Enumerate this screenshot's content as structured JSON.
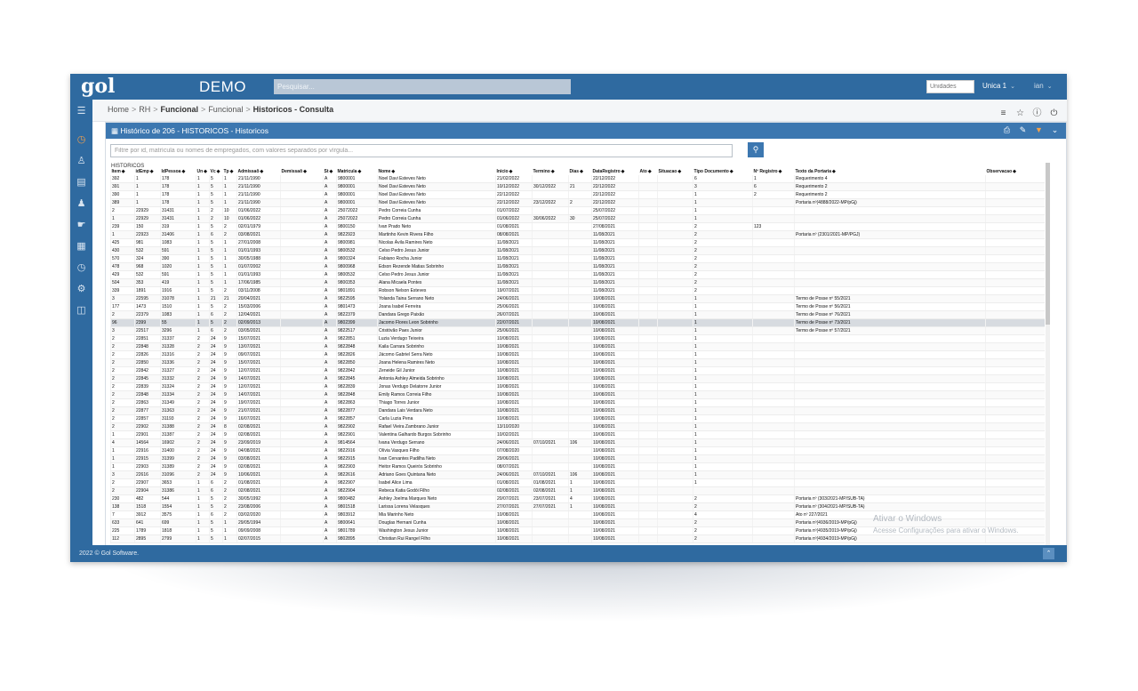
{
  "header": {
    "logo": "gol",
    "app_name": "DEMO",
    "search_placeholder": "Pesquisar...",
    "unidades_label": "Unidades",
    "unit_dropdown": "Unica 1",
    "user_dropdown": "ian"
  },
  "breadcrumb": {
    "items": [
      "Home",
      "RH",
      "Funcional",
      "Funcional",
      "Historicos - Consulta"
    ]
  },
  "panel": {
    "title": "Histórico de 206 - HISTORICOS - Historicos",
    "filter_placeholder": "Filtre por id, matrícula ou nomes de empregados, com valores separados por vírgula...",
    "caption": "HISTORICOS"
  },
  "table": {
    "columns": [
      "Item",
      "idEmp",
      "IdPessoa",
      "Un",
      "Vc",
      "Tp",
      "Admissaõ",
      "Demissaõ",
      "St",
      "Matricula",
      "Nome",
      "Inicio",
      "Termino",
      "Dias",
      "DataRegistro",
      "Ato",
      "Situacao",
      "Tipo Documento",
      "Nº Registro",
      "Texto da Portaria",
      "Observacao"
    ],
    "rows": [
      [
        "392",
        "1",
        "178",
        "1",
        "5",
        "1",
        "21/11/1990",
        "",
        "A",
        "9800001",
        "Noel Davi Esteves Neto",
        "21/02/2022",
        "",
        "",
        "22/12/2022",
        "",
        "",
        "6",
        "1",
        "Requerimento 4",
        ""
      ],
      [
        "391",
        "1",
        "178",
        "1",
        "5",
        "1",
        "21/11/1990",
        "",
        "A",
        "9800001",
        "Noel Davi Esteves Neto",
        "10/12/2022",
        "30/12/2022",
        "21",
        "22/12/2022",
        "",
        "",
        "3",
        "6",
        "Requerimento 2",
        ""
      ],
      [
        "390",
        "1",
        "178",
        "1",
        "5",
        "1",
        "21/11/1990",
        "",
        "A",
        "9800001",
        "Noel Davi Esteves Neto",
        "22/12/2022",
        "",
        "",
        "22/12/2022",
        "",
        "",
        "1",
        "2",
        "Requerimento 2",
        ""
      ],
      [
        "389",
        "1",
        "178",
        "1",
        "5",
        "1",
        "21/11/1990",
        "",
        "A",
        "9800001",
        "Noel Davi Esteves Neto",
        "22/12/2022",
        "23/12/2022",
        "2",
        "22/12/2022",
        "",
        "",
        "1",
        "",
        "Portaria nº(4888/2022-MP/pGj)",
        ""
      ],
      [
        "2",
        "22929",
        "31431",
        "1",
        "2",
        "10",
        "01/06/2022",
        "",
        "A",
        "25072022",
        "Pedro Correia Cunha",
        "01/07/2022",
        "",
        "",
        "25/07/2022",
        "",
        "",
        "1",
        "",
        "",
        ""
      ],
      [
        "1",
        "22929",
        "31431",
        "1",
        "2",
        "10",
        "01/06/2022",
        "",
        "A",
        "25072022",
        "Pedro Correia Cunha",
        "01/06/2022",
        "30/06/2022",
        "30",
        "25/07/2022",
        "",
        "",
        "1",
        "",
        "",
        ""
      ],
      [
        "239",
        "150",
        "319",
        "1",
        "5",
        "2",
        "02/01/1979",
        "",
        "A",
        "9800150",
        "Ivan Prado Neto",
        "01/08/2021",
        "",
        "",
        "27/08/2021",
        "",
        "",
        "2",
        "123",
        "",
        ""
      ],
      [
        "1",
        "22923",
        "31406",
        "1",
        "6",
        "2",
        "03/08/2021",
        "",
        "A",
        "9822923",
        "Martinho Kevin Rivera Filho",
        "08/08/2021",
        "",
        "",
        "11/08/2021",
        "",
        "",
        "2",
        "",
        "Portaria nº (2301/2021-MP/PGJ)",
        ""
      ],
      [
        "425",
        "981",
        "1083",
        "1",
        "5",
        "1",
        "27/01/2008",
        "",
        "A",
        "9800981",
        "Nicolas Ávila Ramires Neto",
        "11/08/2021",
        "",
        "",
        "11/08/2021",
        "",
        "",
        "2",
        "",
        "",
        ""
      ],
      [
        "430",
        "532",
        "591",
        "1",
        "5",
        "1",
        "01/01/1993",
        "",
        "A",
        "9800532",
        "Celso Pedro Jesus Junior",
        "11/08/2021",
        "",
        "",
        "11/08/2021",
        "",
        "",
        "2",
        "",
        "",
        ""
      ],
      [
        "570",
        "324",
        "390",
        "1",
        "5",
        "1",
        "30/05/1988",
        "",
        "A",
        "9800324",
        "Fabiano Rocha Junior",
        "11/08/2021",
        "",
        "",
        "11/08/2021",
        "",
        "",
        "2",
        "",
        "",
        ""
      ],
      [
        "478",
        "968",
        "1020",
        "1",
        "5",
        "1",
        "01/07/2002",
        "",
        "A",
        "9800968",
        "Edson Rezende Matias Sobrinho",
        "11/08/2021",
        "",
        "",
        "11/08/2021",
        "",
        "",
        "2",
        "",
        "",
        ""
      ],
      [
        "429",
        "532",
        "591",
        "1",
        "5",
        "1",
        "01/01/1993",
        "",
        "A",
        "9800532",
        "Celso Pedro Jesus Junior",
        "11/08/2021",
        "",
        "",
        "11/08/2021",
        "",
        "",
        "2",
        "",
        "",
        ""
      ],
      [
        "504",
        "353",
        "419",
        "1",
        "5",
        "1",
        "17/06/1985",
        "",
        "A",
        "9800353",
        "Alana Micaela Pontes",
        "11/08/2021",
        "",
        "",
        "11/08/2021",
        "",
        "",
        "2",
        "",
        "",
        ""
      ],
      [
        "339",
        "1891",
        "1916",
        "1",
        "5",
        "2",
        "03/11/2008",
        "",
        "A",
        "9801891",
        "Robson Nelson Esteves",
        "19/07/2021",
        "",
        "",
        "11/08/2021",
        "",
        "",
        "2",
        "",
        "",
        ""
      ],
      [
        "3",
        "22595",
        "31078",
        "1",
        "21",
        "21",
        "20/04/2021",
        "",
        "A",
        "9822595",
        "Yolanda Taina Serrano Neto",
        "24/06/2021",
        "",
        "",
        "10/08/2021",
        "",
        "",
        "1",
        "",
        "Termo de Posse nº 55/2021",
        ""
      ],
      [
        "177",
        "1473",
        "1510",
        "1",
        "5",
        "2",
        "15/03/2006",
        "",
        "A",
        "9801473",
        "Joana Isabel Ferreira",
        "25/06/2021",
        "",
        "",
        "10/08/2021",
        "",
        "",
        "1",
        "",
        "Termo de Posse nº 56/2021",
        ""
      ],
      [
        "2",
        "22379",
        "1083",
        "1",
        "6",
        "2",
        "12/04/2021",
        "",
        "A",
        "9822379",
        "Dandara Grego Paixão",
        "26/07/2021",
        "",
        "",
        "10/08/2021",
        "",
        "",
        "1",
        "",
        "Termo de Posse nº 76/2021",
        ""
      ],
      [
        "96",
        "2399",
        "55",
        "1",
        "5",
        "2",
        "02/09/2013",
        "",
        "A",
        "9802399",
        "Jacomo Flores Leon Sobrinho",
        "22/07/2021",
        "",
        "",
        "10/08/2021",
        "",
        "",
        "1",
        "",
        "Termo de Posse nº 73/2021",
        ""
      ],
      [
        "3",
        "22517",
        "3296",
        "1",
        "6",
        "2",
        "03/05/2021",
        "",
        "A",
        "9822517",
        "Cristóvão Paes Junior",
        "25/06/2021",
        "",
        "",
        "10/08/2021",
        "",
        "",
        "1",
        "",
        "Termo de Posse nº 57/2021",
        ""
      ],
      [
        "2",
        "22851",
        "31337",
        "2",
        "24",
        "9",
        "15/07/2021",
        "",
        "A",
        "9822851",
        "Luzia Verdugo Teixeira",
        "10/08/2021",
        "",
        "",
        "10/08/2021",
        "",
        "",
        "1",
        "",
        "",
        ""
      ],
      [
        "2",
        "22848",
        "31328",
        "2",
        "24",
        "9",
        "13/07/2021",
        "",
        "A",
        "9822848",
        "Kaila Carrara Sobrinho",
        "10/08/2021",
        "",
        "",
        "10/08/2021",
        "",
        "",
        "1",
        "",
        "",
        ""
      ],
      [
        "2",
        "22826",
        "31316",
        "2",
        "24",
        "9",
        "09/07/2021",
        "",
        "A",
        "9822826",
        "Jácomo Gabriel Serra Neto",
        "10/08/2021",
        "",
        "",
        "10/08/2021",
        "",
        "",
        "1",
        "",
        "",
        ""
      ],
      [
        "2",
        "22850",
        "31336",
        "2",
        "24",
        "9",
        "15/07/2021",
        "",
        "A",
        "9822850",
        "Joana Helena Ramires Neto",
        "10/08/2021",
        "",
        "",
        "10/08/2021",
        "",
        "",
        "1",
        "",
        "",
        ""
      ],
      [
        "2",
        "22842",
        "31327",
        "2",
        "24",
        "9",
        "12/07/2021",
        "",
        "A",
        "9822842",
        "Zeneide Gil Junior",
        "10/08/2021",
        "",
        "",
        "10/08/2021",
        "",
        "",
        "1",
        "",
        "",
        ""
      ],
      [
        "2",
        "22845",
        "31332",
        "2",
        "24",
        "9",
        "14/07/2021",
        "",
        "A",
        "9822845",
        "Antonia Ashley Almeida Sobrinho",
        "10/08/2021",
        "",
        "",
        "10/08/2021",
        "",
        "",
        "1",
        "",
        "",
        ""
      ],
      [
        "2",
        "22839",
        "31324",
        "2",
        "24",
        "9",
        "12/07/2021",
        "",
        "A",
        "9822839",
        "Jonas Verdugo Delatorre Junior",
        "10/08/2021",
        "",
        "",
        "10/08/2021",
        "",
        "",
        "1",
        "",
        "",
        ""
      ],
      [
        "2",
        "22848",
        "31334",
        "2",
        "24",
        "9",
        "14/07/2021",
        "",
        "A",
        "9822848",
        "Emily Ramos Correia Filho",
        "10/08/2021",
        "",
        "",
        "10/08/2021",
        "",
        "",
        "1",
        "",
        "",
        ""
      ],
      [
        "2",
        "22863",
        "31349",
        "2",
        "24",
        "9",
        "19/07/2021",
        "",
        "A",
        "9822863",
        "Thiago Torres Junior",
        "10/08/2021",
        "",
        "",
        "10/08/2021",
        "",
        "",
        "1",
        "",
        "",
        ""
      ],
      [
        "2",
        "22877",
        "31363",
        "2",
        "24",
        "9",
        "21/07/2021",
        "",
        "A",
        "9822877",
        "Dandara Lais Verdara Neto",
        "10/08/2021",
        "",
        "",
        "10/08/2021",
        "",
        "",
        "1",
        "",
        "",
        ""
      ],
      [
        "2",
        "22857",
        "31193",
        "2",
        "24",
        "9",
        "16/07/2021",
        "",
        "A",
        "9822857",
        "Carla Luzia Pena",
        "10/08/2021",
        "",
        "",
        "10/08/2021",
        "",
        "",
        "1",
        "",
        "",
        ""
      ],
      [
        "2",
        "22902",
        "31388",
        "2",
        "24",
        "8",
        "02/08/2021",
        "",
        "A",
        "9822902",
        "Rafael Vieira Zambrano Junior",
        "13/10/2020",
        "",
        "",
        "10/08/2021",
        "",
        "",
        "1",
        "",
        "",
        ""
      ],
      [
        "1",
        "22901",
        "31387",
        "2",
        "24",
        "9",
        "02/08/2021",
        "",
        "A",
        "9822901",
        "Valentina Galhardo Burgos Sobrinho",
        "10/02/2021",
        "",
        "",
        "10/08/2021",
        "",
        "",
        "1",
        "",
        "",
        ""
      ],
      [
        "4",
        "14564",
        "16902",
        "2",
        "24",
        "9",
        "23/09/2019",
        "",
        "A",
        "9814564",
        "Ivana Verdugo Serrano",
        "24/06/2021",
        "07/10/2021",
        "106",
        "10/08/2021",
        "",
        "",
        "1",
        "",
        "",
        ""
      ],
      [
        "1",
        "22916",
        "31400",
        "2",
        "24",
        "9",
        "04/08/2021",
        "",
        "A",
        "9822916",
        "Olívia Vasques Filho",
        "07/08/2020",
        "",
        "",
        "10/08/2021",
        "",
        "",
        "1",
        "",
        "",
        ""
      ],
      [
        "1",
        "22915",
        "31399",
        "2",
        "24",
        "9",
        "03/08/2021",
        "",
        "A",
        "9822915",
        "Ivan Cervantes Padilha Neto",
        "29/06/2021",
        "",
        "",
        "10/08/2021",
        "",
        "",
        "1",
        "",
        "",
        ""
      ],
      [
        "1",
        "22903",
        "31389",
        "2",
        "24",
        "9",
        "02/08/2021",
        "",
        "A",
        "9822903",
        "Heitor Ramos Queirós Sobrinho",
        "08/07/2021",
        "",
        "",
        "10/08/2021",
        "",
        "",
        "1",
        "",
        "",
        ""
      ],
      [
        "3",
        "22616",
        "31096",
        "2",
        "24",
        "9",
        "10/06/2021",
        "",
        "A",
        "9822616",
        "Adriano Goes Quintana Neto",
        "24/06/2021",
        "07/10/2021",
        "106",
        "10/08/2021",
        "",
        "",
        "1",
        "",
        "",
        ""
      ],
      [
        "2",
        "22907",
        "3653",
        "1",
        "6",
        "2",
        "01/08/2021",
        "",
        "A",
        "9822907",
        "Isabel Alice Lima",
        "01/08/2021",
        "01/08/2021",
        "1",
        "10/08/2021",
        "",
        "",
        "1",
        "",
        "",
        ""
      ],
      [
        "2",
        "22904",
        "31386",
        "1",
        "6",
        "2",
        "02/08/2021",
        "",
        "A",
        "9822904",
        "Rebeca Katia Godói Filho",
        "02/08/2021",
        "02/08/2021",
        "1",
        "10/08/2021",
        "",
        "",
        "",
        "",
        "",
        ""
      ],
      [
        "230",
        "482",
        "544",
        "1",
        "5",
        "2",
        "30/05/1992",
        "",
        "A",
        "9800482",
        "Ashley Joelma Marques Neto",
        "20/07/2021",
        "23/07/2021",
        "4",
        "10/08/2021",
        "",
        "",
        "2",
        "",
        "Portaria nº (303/2021-MP/SUB-TA)",
        ""
      ],
      [
        "138",
        "1518",
        "1554",
        "1",
        "5",
        "2",
        "23/08/2006",
        "",
        "A",
        "9801518",
        "Larissa Lorena Velasques",
        "27/07/2021",
        "27/07/2021",
        "1",
        "10/08/2021",
        "",
        "",
        "2",
        "",
        "Portaria nº (304/2021-MP/SUB-TA)",
        ""
      ],
      [
        "7",
        "3912",
        "3575",
        "1",
        "6",
        "2",
        "03/02/2020",
        "",
        "A",
        "9803912",
        "Mia Marinho Neto",
        "10/08/2021",
        "",
        "",
        "10/08/2021",
        "",
        "",
        "4",
        "",
        "Ato nº 227/2021",
        ""
      ],
      [
        "633",
        "641",
        "699",
        "1",
        "5",
        "1",
        "29/05/1994",
        "",
        "A",
        "9800641",
        "Douglas Hernani Cunha",
        "10/08/2021",
        "",
        "",
        "10/08/2021",
        "",
        "",
        "2",
        "",
        "Portaria nº(4936/2019-MP/pGj)",
        ""
      ],
      [
        "225",
        "1789",
        "1818",
        "1",
        "5",
        "1",
        "09/09/2008",
        "",
        "A",
        "9801789",
        "Washington Jesus Junior",
        "10/08/2021",
        "",
        "",
        "10/08/2021",
        "",
        "",
        "2",
        "",
        "Portaria nº(4935/2019-MP/pGj)",
        ""
      ],
      [
        "112",
        "2895",
        "2799",
        "1",
        "5",
        "1",
        "02/07/2015",
        "",
        "A",
        "9802895",
        "Christian Rui Rangel Filho",
        "10/08/2021",
        "",
        "",
        "10/08/2021",
        "",
        "",
        "2",
        "",
        "Portaria nº(4934/2019-MP/pGj)",
        ""
      ]
    ]
  },
  "footer": {
    "copyright": "2022 © Gol Software."
  },
  "watermark": {
    "line1": "Ativar o Windows",
    "line2": "Acesse Configurações para ativar o Windows."
  },
  "colors": {
    "brand": "#2f6aa0",
    "panel_header": "#3c77b0",
    "accent": "#f4a24a"
  }
}
